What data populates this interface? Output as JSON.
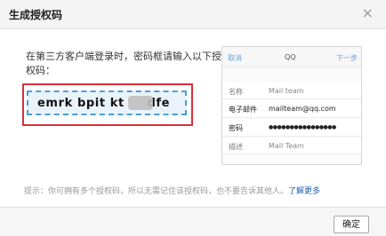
{
  "dialog": {
    "title": "生成授权码",
    "close_glyph": "×",
    "instruction": "在第三方客户端登录时，密码框请输入以下授权码：",
    "auth_code": "emrk bpit kt     dfe",
    "tip": "提示：你可拥有多个授权码，所以无需记住该授权码，也不要告诉其他人。",
    "learn_more": "了解更多",
    "ok_button": "确定"
  },
  "phone_preview": {
    "cancel": "取消",
    "title": "QQ",
    "next": "下一步",
    "rows": [
      {
        "label": "名称",
        "value": "Mail team"
      },
      {
        "label": "电子邮件",
        "value": "mailteam@qq.com"
      },
      {
        "label": "密码",
        "value": "●●●●●●●●●●●●●●●●"
      },
      {
        "label": "描述",
        "value": "Mail Team"
      }
    ]
  },
  "icons": {
    "close": "close-icon"
  }
}
